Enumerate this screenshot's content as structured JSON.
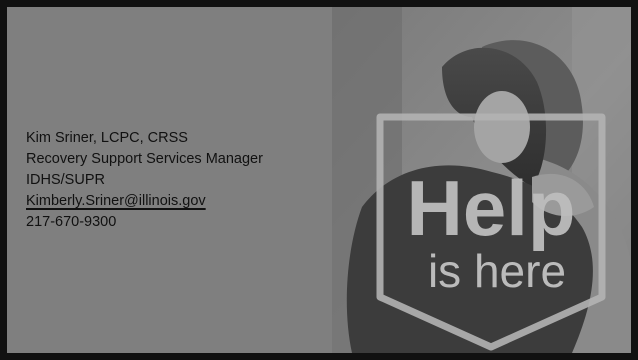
{
  "contact": {
    "name": "Kim Sriner, LCPC, CRSS",
    "title": "Recovery Support Services Manager",
    "organization": "IDHS/SUPR",
    "email": "Kimberly.Sriner@illinois.gov",
    "phone": "217-670-9300"
  },
  "image": {
    "logo_word": "Help",
    "logo_tagline": "is here"
  },
  "colors": {
    "frame": "#111111",
    "panel": "#7f7f7f",
    "text": "#111111",
    "logo": "#b5b5b5"
  }
}
